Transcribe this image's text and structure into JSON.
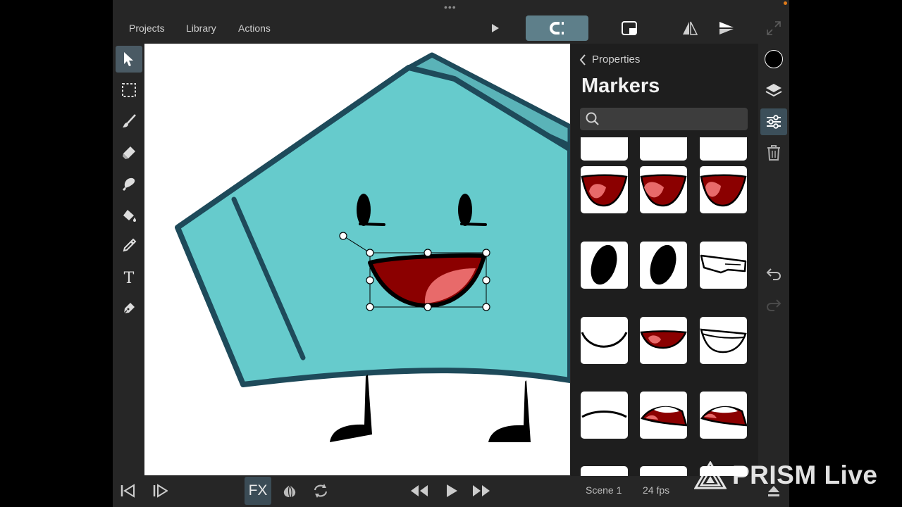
{
  "menu": {
    "projects": "Projects",
    "library": "Library",
    "actions": "Actions"
  },
  "panel": {
    "back_label": "Properties",
    "title": "Markers",
    "search_placeholder": ""
  },
  "markers": [
    {
      "icon": "mouth-open-dark-red"
    },
    {
      "icon": "mouth-open-dark-red"
    },
    {
      "icon": "mouth-open-dark-red"
    },
    {
      "icon": "eye-oval-tilted-left"
    },
    {
      "icon": "eye-oval-tilted-right"
    },
    {
      "icon": "mouth-closed-flat-teeth"
    },
    {
      "icon": "mouth-smile-line"
    },
    {
      "icon": "mouth-open-small-red"
    },
    {
      "icon": "mouth-grin-teeth"
    },
    {
      "icon": "mouth-neutral-line"
    },
    {
      "icon": "mouth-side-open-red"
    },
    {
      "icon": "mouth-side-open-red-2"
    }
  ],
  "footer": {
    "fx_label": "FX",
    "scene_label": "Scene 1",
    "fps_label": "24 fps"
  },
  "watermark": {
    "text": "PRISM Live"
  },
  "colors": {
    "app_bg": "#262626",
    "panel_bg": "#1e1e1e",
    "accent": "#5e7f8a",
    "character_fill": "#66cbcc",
    "character_stroke": "#1e4a5a",
    "mouth_red": "#8b0000",
    "tongue_pink": "#e86a6a"
  }
}
